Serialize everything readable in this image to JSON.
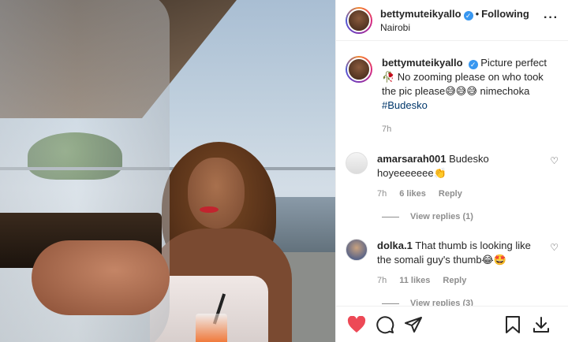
{
  "post": {
    "username": "bettymuteikyallo",
    "verified_icon": "verified-badge-icon",
    "separator": "•",
    "follow_status": "Following",
    "location": "Nairobi",
    "more_icon": "more-options-icon"
  },
  "caption": {
    "username": "bettymuteikyallo",
    "text": "Picture perfect🥀 No zooming please on who took the pic please😅😅😅 nimechoka",
    "hashtag": "#Budesko",
    "time": "7h"
  },
  "comments": [
    {
      "username": "amarsarah001",
      "text": "Budesko hoyeeeeeee👏",
      "time": "7h",
      "likes": "6 likes",
      "reply_label": "Reply",
      "view_replies": "View replies (1)"
    },
    {
      "username": "dolka.1",
      "text": "That thumb is looking like the somali guy's thumb😂🤩",
      "time": "7h",
      "likes": "11 likes",
      "reply_label": "Reply",
      "view_replies": "View replies (3)"
    }
  ],
  "actions": {
    "like_icon": "heart-filled-icon",
    "comment_icon": "comment-icon",
    "share_icon": "share-icon",
    "save_icon": "bookmark-icon",
    "download_icon": "download-icon",
    "like_color": "#ed4956"
  },
  "colors": {
    "accent": "#3897f0",
    "hashtag": "#00376b",
    "muted": "#8e8e8e"
  }
}
